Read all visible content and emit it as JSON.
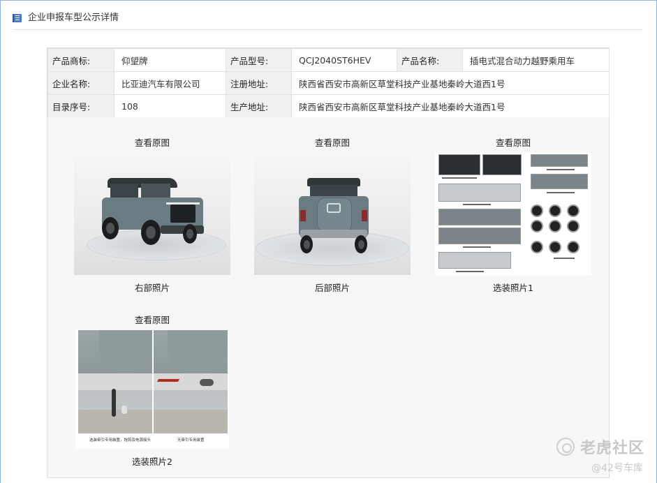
{
  "header": {
    "title": "企业申报车型公示详情",
    "icon": "book-icon"
  },
  "info_rows": [
    [
      {
        "k": "产品商标:",
        "v": "仰望牌"
      },
      {
        "k": "产品型号:",
        "v": "QCJ2040ST6HEV"
      },
      {
        "k": "产品名称:",
        "v": "插电式混合动力越野乘用车"
      }
    ],
    [
      {
        "k": "企业名称:",
        "v": "比亚迪汽车有限公司"
      },
      {
        "k": "注册地址:",
        "v": "陕西省西安市高新区草堂科技产业基地秦岭大道西1号"
      }
    ],
    [
      {
        "k": "目录序号:",
        "v": "108"
      },
      {
        "k": "生产地址:",
        "v": "陕西省西安市高新区草堂科技产业基地秦岭大道西1号"
      }
    ]
  ],
  "photos": [
    {
      "link": "查看原图",
      "caption": "右部照片"
    },
    {
      "link": "查看原图",
      "caption": "后部照片"
    },
    {
      "link": "查看原图",
      "caption": "选装照片1"
    },
    {
      "link": "查看原图",
      "caption": "选装照片2"
    }
  ],
  "hitch_captions": [
    "选装牵引专用装置，拖钩及电源接头",
    "无牵引专用装置"
  ],
  "watermark": {
    "main": "老虎社区",
    "sub": "@42号车库"
  },
  "colors": {
    "frame_border": "#8fb3e0",
    "key_bg": "#f0f0f0",
    "panel_bg": "#f7f7f7",
    "car_body": "#6a7c82"
  }
}
